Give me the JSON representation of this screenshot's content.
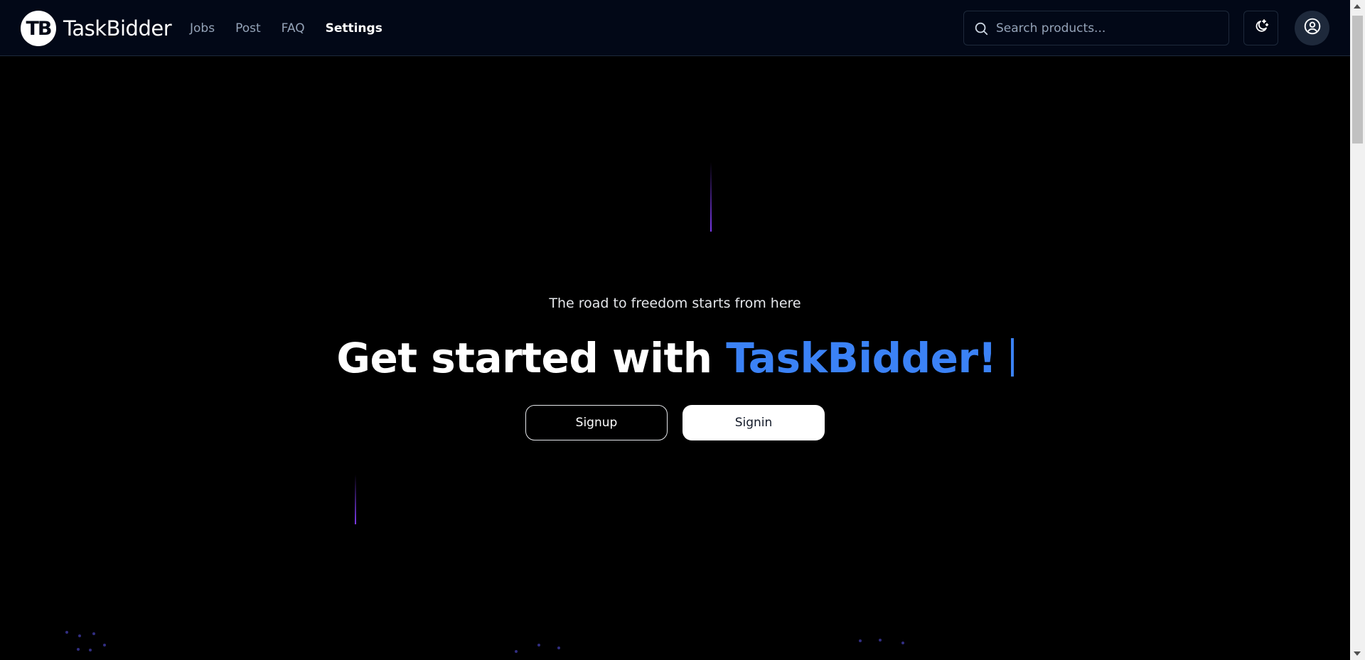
{
  "brand": {
    "logo_text": "TB",
    "name": "TaskBidder"
  },
  "nav": {
    "items": [
      {
        "label": "Jobs",
        "active": false
      },
      {
        "label": "Post",
        "active": false
      },
      {
        "label": "FAQ",
        "active": false
      },
      {
        "label": "Settings",
        "active": true
      }
    ]
  },
  "search": {
    "placeholder": "Search products...",
    "icon": "search-icon"
  },
  "header_actions": {
    "theme_icon": "moon-stars-icon",
    "profile_icon": "user-circle-icon"
  },
  "hero": {
    "tagline": "The road to freedom starts from here",
    "title_prefix": "Get started with ",
    "title_accent": "TaskBidder!",
    "signup_label": "Signup",
    "signin_label": "Signin"
  },
  "colors": {
    "background": "#000000",
    "navbar": "#020817",
    "accent": "#3b82f6",
    "meteor": "#7c3aed"
  }
}
